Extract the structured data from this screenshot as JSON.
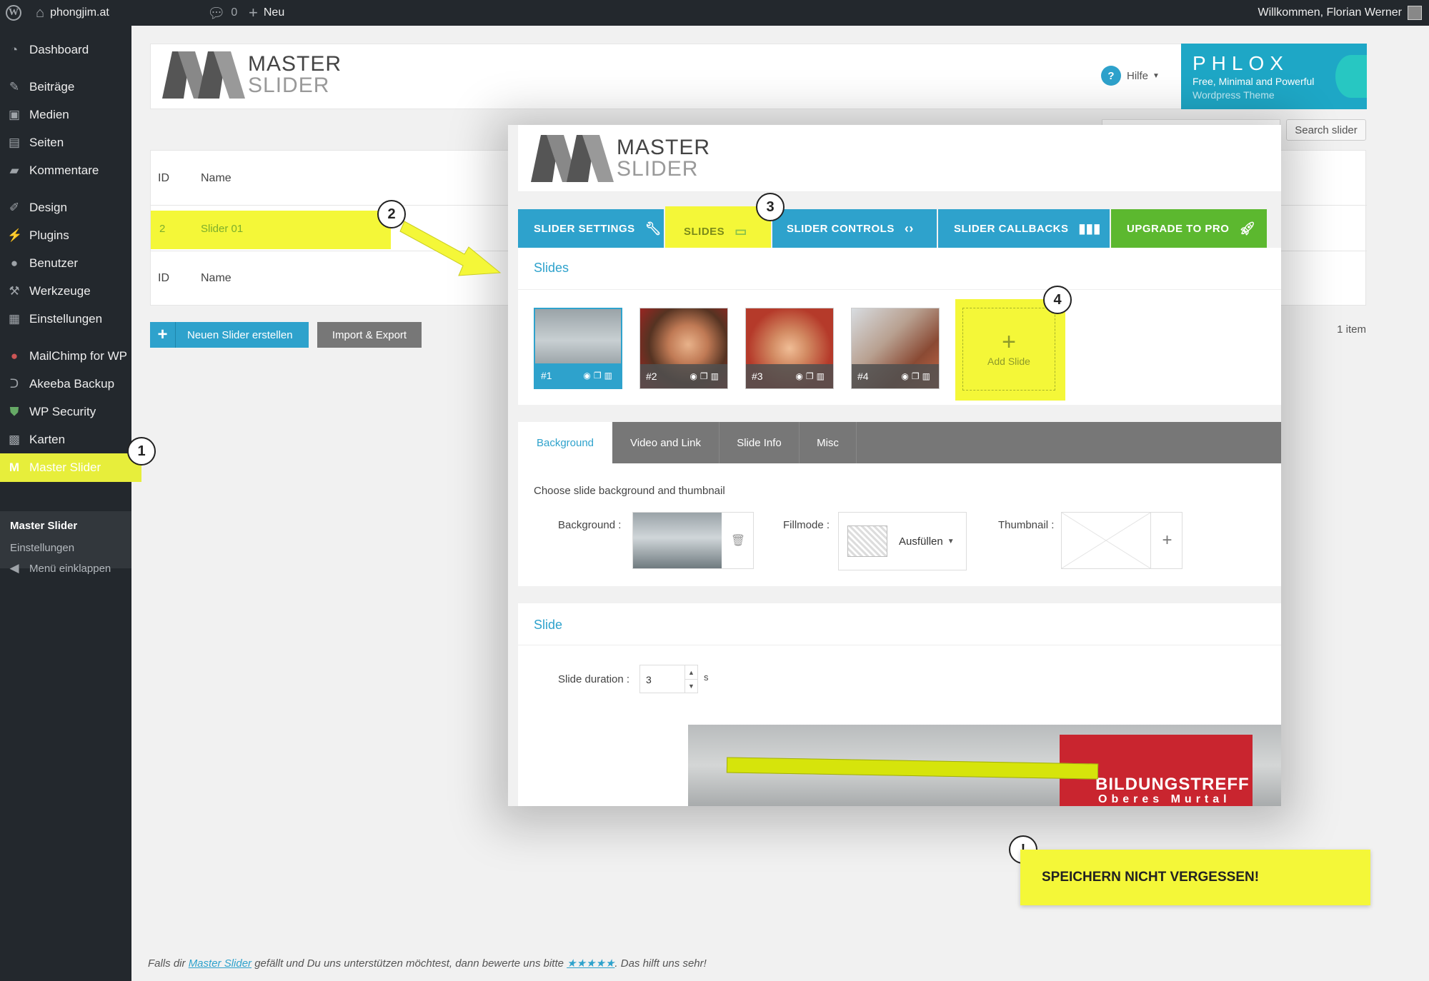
{
  "adminbar": {
    "site_name": "phongjim.at",
    "comments_count": "0",
    "new_label": "Neu",
    "welcome": "Willkommen, Florian Werner"
  },
  "sidebar": {
    "items": [
      {
        "label": "Dashboard",
        "icon": "dashboard-icon"
      },
      {
        "label": "Beiträge",
        "icon": "pin-icon"
      },
      {
        "label": "Medien",
        "icon": "media-icon"
      },
      {
        "label": "Seiten",
        "icon": "pages-icon"
      },
      {
        "label": "Kommentare",
        "icon": "comments-icon"
      },
      {
        "label": "Design",
        "icon": "brush-icon"
      },
      {
        "label": "Plugins",
        "icon": "plugins-icon"
      },
      {
        "label": "Benutzer",
        "icon": "user-icon"
      },
      {
        "label": "Werkzeuge",
        "icon": "tools-icon"
      },
      {
        "label": "Einstellungen",
        "icon": "settings-icon"
      },
      {
        "label": "MailChimp for WP",
        "icon": "mailchimp-icon"
      },
      {
        "label": "Akeeba Backup",
        "icon": "backup-icon"
      },
      {
        "label": "WP Security",
        "icon": "shield-icon"
      },
      {
        "label": "Karten",
        "icon": "map-icon"
      },
      {
        "label": "Master Slider",
        "icon": "master-slider-icon"
      }
    ],
    "submenu": [
      "Master Slider",
      "Einstellungen"
    ],
    "collapse_label": "Menü einklappen"
  },
  "background_page": {
    "logo_word1": "MASTER",
    "logo_word2": "SLIDER",
    "help_label": "Hilfe",
    "ad_title": "PHLOX",
    "ad_line1": "Free, Minimal and Powerful",
    "ad_line2": "Wordpress Theme",
    "search_button": "Search slider",
    "col_id": "ID",
    "col_name": "Name",
    "row_id": "2",
    "row_name": "Slider 01",
    "new_slider_button": "Neuen Slider erstellen",
    "import_export_button": "Import & Export",
    "item_count": "1 item",
    "footer_pre": "Falls dir ",
    "footer_link": "Master Slider",
    "footer_mid": " gefällt und Du uns unterstützen möchtest, dann bewerte uns bitte ",
    "footer_stars": "★★★★★",
    "footer_post": ". Das hilft uns sehr!"
  },
  "overlay": {
    "logo_word1": "MASTER",
    "logo_word2": "SLIDER",
    "tabs": [
      {
        "label": "SLIDER SETTINGS",
        "icon": "wrench-icon"
      },
      {
        "label": "SLIDES",
        "icon": "slides-icon"
      },
      {
        "label": "SLIDER CONTROLS",
        "icon": "arrows-icon"
      },
      {
        "label": "SLIDER CALLBACKS",
        "icon": "callbacks-icon"
      },
      {
        "label": "UPGRADE TO PRO",
        "icon": "rocket-icon"
      }
    ],
    "slides_title": "Slides",
    "slides": [
      "#1",
      "#2",
      "#3",
      "#4"
    ],
    "add_slide_label": "Add Slide",
    "sub_tabs": [
      "Background",
      "Video and Link",
      "Slide Info",
      "Misc"
    ],
    "bg_hint": "Choose slide background and thumbnail",
    "bg_label": "Background :",
    "fillmode_label": "Fillmode :",
    "fillmode_value": "Ausfüllen",
    "thumbnail_label": "Thumbnail :",
    "slide_title": "Slide",
    "duration_label": "Slide duration :",
    "duration_value": "3",
    "duration_unit": "s",
    "preview_text1": "BILDUNGSTREFF",
    "preview_text2": "Oberes Murtal"
  },
  "annotations": {
    "callouts": [
      "1",
      "2",
      "3",
      "4",
      "!"
    ],
    "reminder": "SPEICHERN NICHT VERGESSEN!"
  },
  "colors": {
    "wp_dark": "#23282d",
    "ms_blue": "#2ea2cc",
    "ms_green": "#5cb82f",
    "highlight_yellow": "#f4f738"
  }
}
